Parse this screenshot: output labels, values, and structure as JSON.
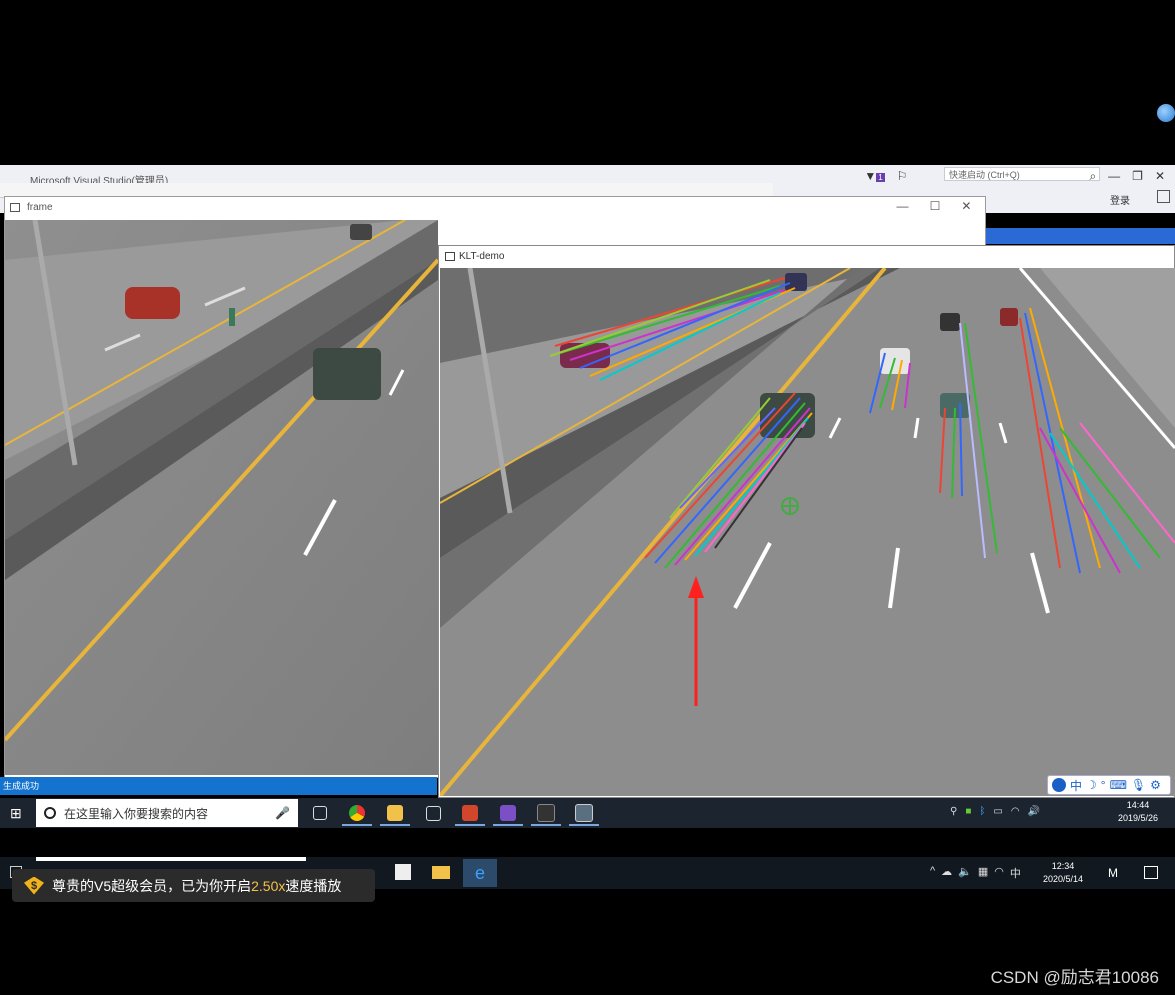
{
  "vs": {
    "title": "Microsoft Visual Studio(管理员)",
    "quick_launch_placeholder": "快速启动 (Ctrl+Q)",
    "login": "登录",
    "status": "生成成功",
    "notification_count": "1"
  },
  "frame_window": {
    "title": "frame",
    "controls": [
      "—",
      "☐",
      "✕"
    ]
  },
  "klt_window": {
    "title": "KLT-demo"
  },
  "ime": {
    "mode": "中"
  },
  "taskbar_inner": {
    "search_placeholder": "在这里输入你要搜索的内容",
    "time": "14:44",
    "date": "2019/5/26"
  },
  "taskbar_outer": {
    "ime_mode": "中",
    "time": "12:34",
    "date": "2020/5/14"
  },
  "vip_toast": {
    "icon_label": "$",
    "text_before": "尊贵的V5超级会员，已为你开启",
    "speed": "2.50x",
    "text_after": "速度播放"
  },
  "watermark": "CSDN @励志君10086",
  "colors": {
    "vs_blue": "#1473cf",
    "annotation_arrow": "#ff2020",
    "road": "#8d8d8d",
    "lane_yellow": "#e8b53a"
  }
}
